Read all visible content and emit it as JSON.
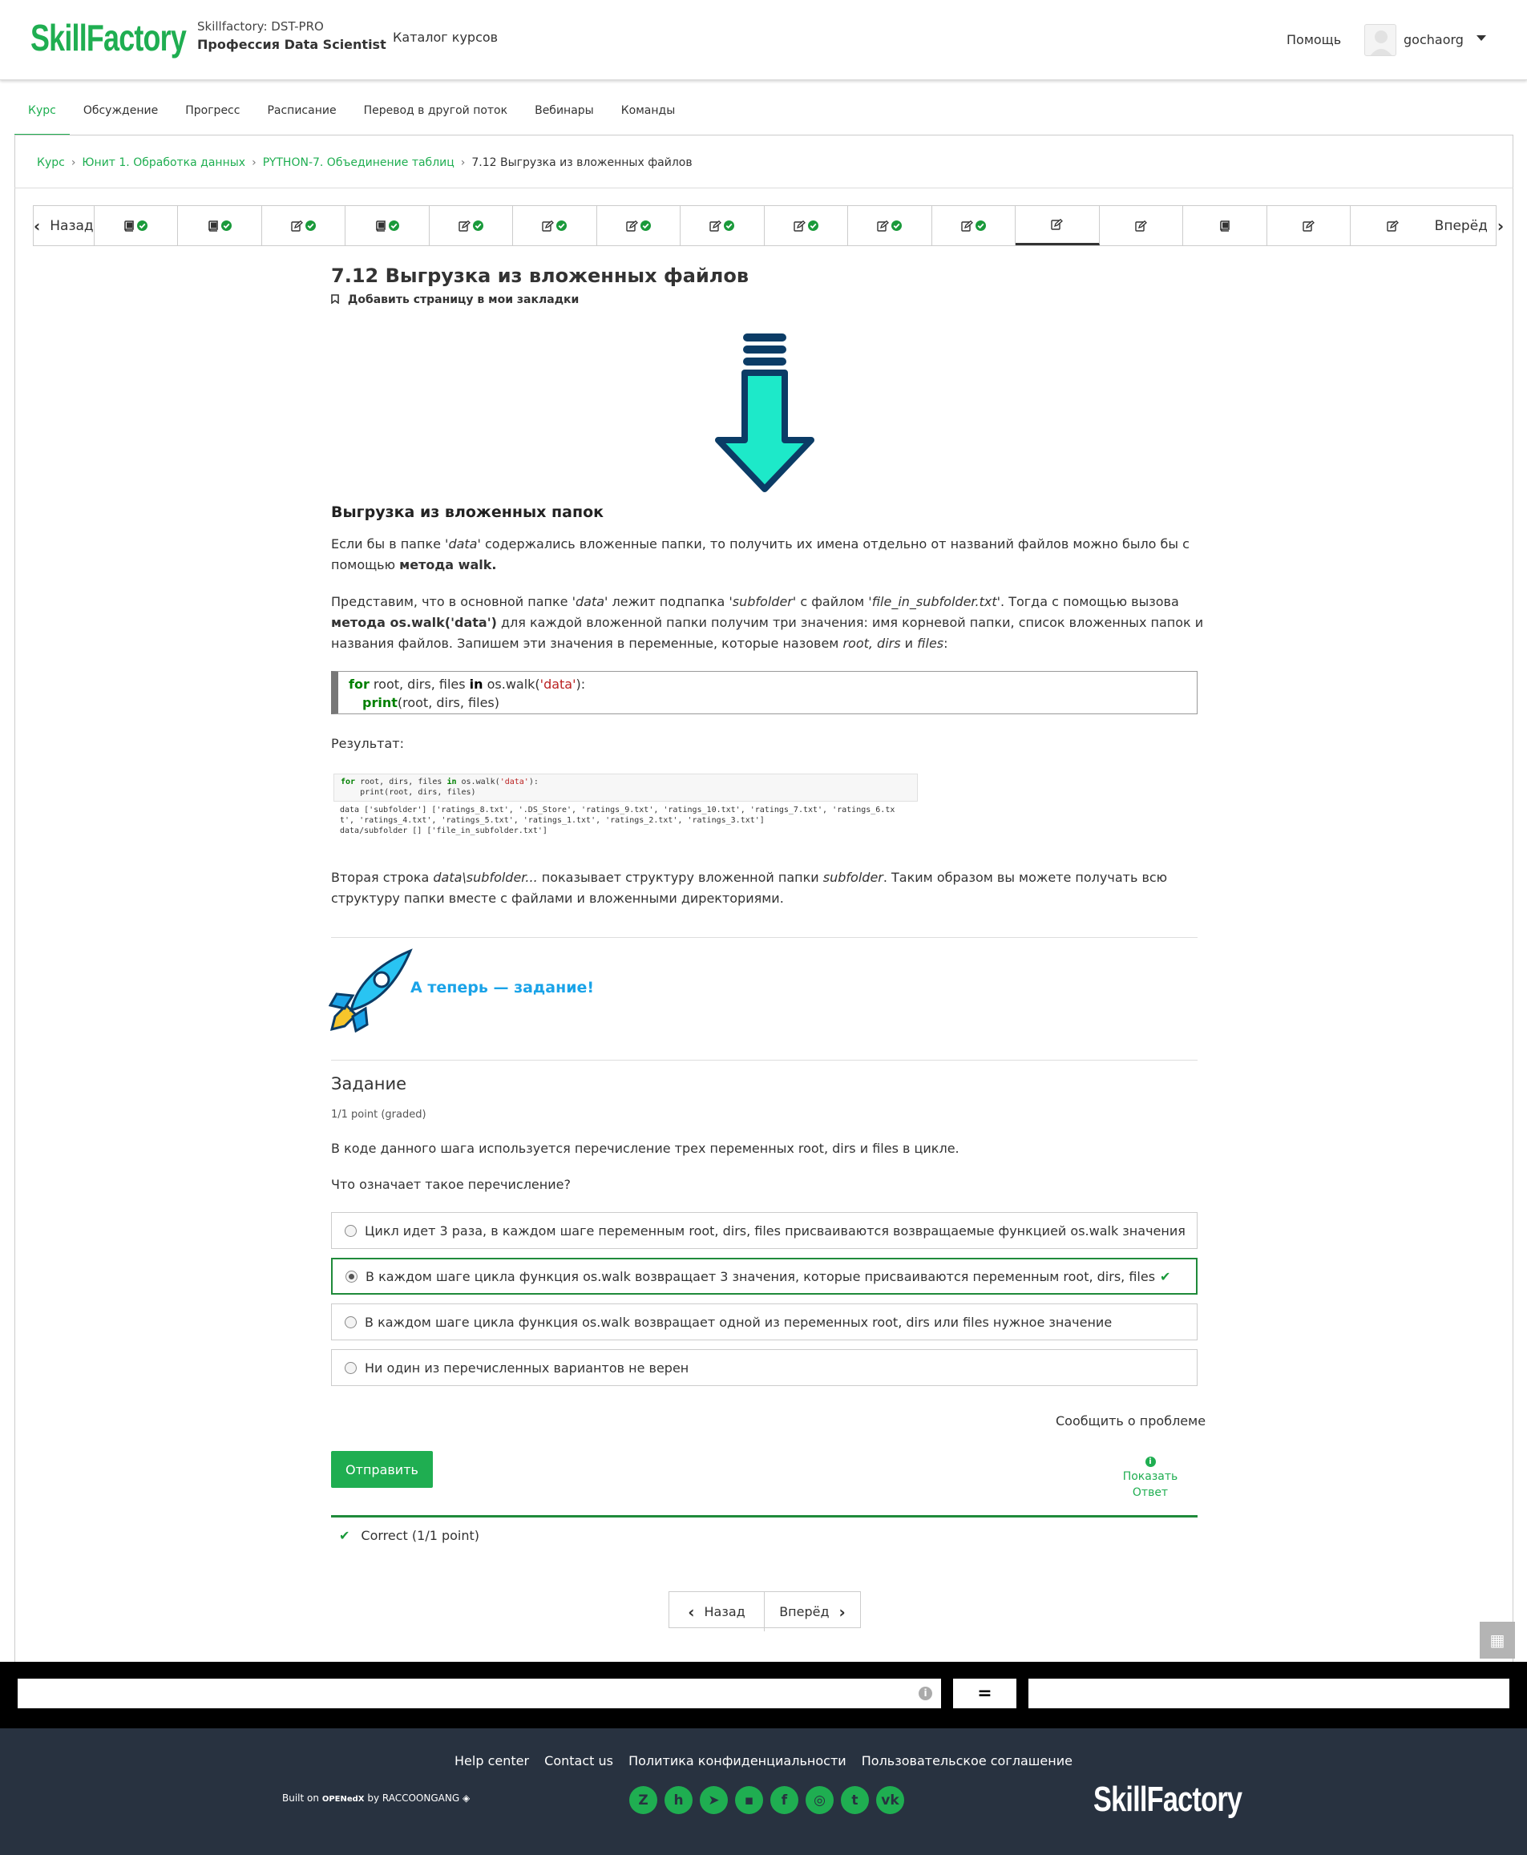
{
  "header": {
    "logo": "SkillFactory",
    "course_org": "Skillfactory: DST-PRO",
    "course_name": "Профессия Data Scientist",
    "catalog": "Каталог курсов",
    "help": "Помощь",
    "username": "gochaorg"
  },
  "tabs": [
    "Курс",
    "Обсуждение",
    "Прогресс",
    "Расписание",
    "Перевод в другой поток",
    "Вебинары",
    "Команды"
  ],
  "breadcrumbs": {
    "c1": "Курс",
    "c2": "Юнит 1. Обработка данных",
    "c3": "PYTHON-7. Объединение таблиц",
    "current": "7.12 Выгрузка из вложенных файлов",
    "sep": "›"
  },
  "seqnav": {
    "prev": "Назад",
    "next": "Вперёд",
    "items": [
      {
        "icon": "book-icon",
        "done": true
      },
      {
        "icon": "book-icon",
        "done": true
      },
      {
        "icon": "edit-icon",
        "done": true
      },
      {
        "icon": "book-icon",
        "done": true
      },
      {
        "icon": "edit-icon",
        "done": true
      },
      {
        "icon": "edit-icon",
        "done": true
      },
      {
        "icon": "edit-icon",
        "done": true
      },
      {
        "icon": "edit-icon",
        "done": true
      },
      {
        "icon": "edit-icon",
        "done": true
      },
      {
        "icon": "edit-icon",
        "done": true
      },
      {
        "icon": "edit-icon",
        "done": true
      },
      {
        "icon": "edit-icon",
        "done": false,
        "current": true
      },
      {
        "icon": "edit-icon",
        "done": false
      },
      {
        "icon": "book-icon",
        "done": false
      },
      {
        "icon": "edit-icon",
        "done": false
      },
      {
        "icon": "edit-icon",
        "done": false
      }
    ]
  },
  "content": {
    "title": "7.12 Выгрузка из вложенных файлов",
    "bookmark": "Добавить страницу в мои закладки",
    "section_heading": "Выгрузка из вложенных папок",
    "para1": {
      "t1": "Если бы в папке ",
      "i1": "'data'",
      "t2": " содержались вложенные папки, то получить их имена отдельно от названий файлов можно было бы с помощью ",
      "b1": "метода walk."
    },
    "para2": {
      "t1": "Представим, что в основной папке ",
      "i1": "'data'",
      "t2": " лежит подпапка ",
      "i2": "'subfolder'",
      "t3": " с файлом ",
      "i3": "'file_in_subfolder.txt'",
      "t4": ". Тогда с помощью вызова ",
      "b1": "метода os.walk('data')",
      "t5": " для каждой вложенной папки получим три значения: имя корневой папки, список вложенных папок и названия файлов. Запишем эти значения в переменные, которые назовем ",
      "i4": "root, dirs",
      "t6": " и ",
      "i5": "files",
      "t7": ":"
    },
    "code": {
      "kw_for": "for",
      "l1a": " root, dirs, files ",
      "kw_in": "in",
      "l1b": " os.walk(",
      "l1str": "'data'",
      "l1c": "):",
      "kw_print": "print",
      "l2": "(root, dirs, files)"
    },
    "result_label": "Результат:",
    "shot": {
      "line1_kw": "for",
      "line1a": " root, dirs, files ",
      "line1_in": "in",
      "line1b": " os.walk(",
      "line1_str": "'data'",
      "line1c": "):",
      "line2": "    print(root, dirs, files)",
      "out1": "data ['subfolder'] ['ratings_8.txt', '.DS_Store', 'ratings_9.txt', 'ratings_10.txt', 'ratings_7.txt', 'ratings_6.tx",
      "out2": "t', 'ratings_4.txt', 'ratings_5.txt', 'ratings_1.txt', 'ratings_2.txt', 'ratings_3.txt']",
      "out3": "data/subfolder [] ['file_in_subfolder.txt']"
    },
    "para3": {
      "t1": "Вторая строка ",
      "i1": "data\\subfolder...",
      "t2": " показывает структуру вложенной папки ",
      "i2": "subfolder",
      "t3": ". Таким образом вы можете получать всю структуру папки вместе с файлами и вложенными директориями."
    },
    "task_banner": "А теперь — задание!"
  },
  "problem": {
    "title": "Задание",
    "points": "1/1 point (graded)",
    "question": "В коде данного шага используется перечисление трех переменных root, dirs и files в цикле.",
    "question2": "Что означает такое перечисление?",
    "options": [
      "Цикл идет 3 раза, в каждом шаге переменным root, dirs, files присваиваются возвращаемые функцией os.walk значения",
      "В каждом шаге цикла функция os.walk возвращает 3 значения, которые присваиваются переменным root, dirs, files",
      "В каждом шаге цикла функция os.walk возвращает одной из переменных root, dirs или files нужное значение",
      "Ни один из перечисленных вариантов не верен"
    ],
    "selected_index": 1,
    "report": "Сообщить о проблеме",
    "submit": "Отправить",
    "show_answer_1": "Показать",
    "show_answer_2": "Ответ",
    "status": "Correct (1/1 point)"
  },
  "bottom_nav": {
    "prev": "Назад",
    "next": "Вперёд"
  },
  "footer": {
    "links": [
      "Help center",
      "Contact us",
      "Политика конфиденциальности",
      "Пользовательское соглашение"
    ],
    "built_on": "Built on",
    "openedx": "OPENedX",
    "by": "by RACCOONGANG",
    "social": [
      "zen-icon",
      "habr-icon",
      "telegram-icon",
      "chat-icon",
      "facebook-icon",
      "instagram-icon",
      "twitter-icon",
      "vk-icon"
    ],
    "logo": "SkillFactory"
  },
  "colors": {
    "brand": "#1fae51",
    "footer_bg": "#283240",
    "task_blue": "#1aa3e8",
    "arrow_fill": "#1de9c9",
    "arrow_stroke": "#0b3c66"
  }
}
